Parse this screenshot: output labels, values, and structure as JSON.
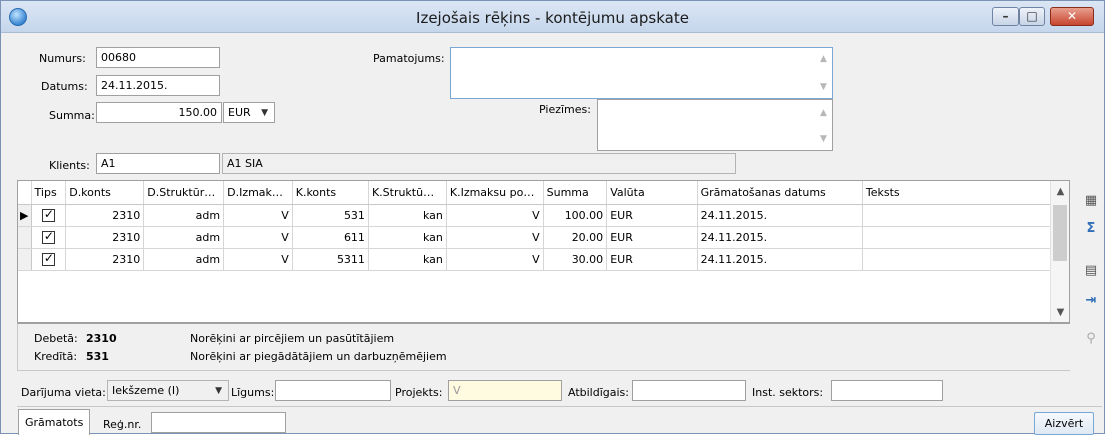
{
  "window": {
    "title": "Izejošais rēķins - kontējumu apskate",
    "min": "–",
    "max": "□",
    "close": "✕"
  },
  "header": {
    "numurs_label": "Numurs:",
    "numurs": "00680",
    "datums_label": "Datums:",
    "datums": "24.11.2015.",
    "summa_label": "Summa:",
    "summa": "150.00",
    "currency": "EUR",
    "pamatojums_label": "Pamatojums:",
    "piezimes_label": "Piezīmes:",
    "klients_label": "Klients:",
    "klients_code": "A1",
    "klients_name": "A1 SIA"
  },
  "grid": {
    "columns": [
      "Tips",
      "D.konts",
      "D.Struktūr…",
      "D.Izmak…",
      "K.konts",
      "K.Struktū…",
      "K.Izmaksu po…",
      "Summa",
      "Valūta",
      "Grāmatošanas datums",
      "Teksts"
    ],
    "rows": [
      {
        "dkonts": "2310",
        "dstr": "adm",
        "dizm": "V",
        "kkonts": "531",
        "kstr": "kan",
        "kizm": "V",
        "summa": "100.00",
        "valuta": "EUR",
        "datums": "24.11.2015.",
        "teksts": ""
      },
      {
        "dkonts": "2310",
        "dstr": "adm",
        "dizm": "V",
        "kkonts": "611",
        "kstr": "kan",
        "kizm": "V",
        "summa": "20.00",
        "valuta": "EUR",
        "datums": "24.11.2015.",
        "teksts": ""
      },
      {
        "dkonts": "2310",
        "dstr": "adm",
        "dizm": "V",
        "kkonts": "5311",
        "kstr": "kan",
        "kizm": "V",
        "summa": "30.00",
        "valuta": "EUR",
        "datums": "24.11.2015.",
        "teksts": ""
      }
    ]
  },
  "info": {
    "debet_label": "Debetā:",
    "debet_value": "2310",
    "debet_desc": "Norēķini ar pircējiem un pasūtītājiem",
    "kredit_label": "Kredītā:",
    "kredit_value": "531",
    "kredit_desc": "Norēķini ar piegādātājiem un darbuzņēmējiem"
  },
  "bottom": {
    "darijuma_label": "Darījuma vieta:",
    "darijuma_value": "Iekšzeme (I)",
    "ligums_label": "Līgums:",
    "projekts_label": "Projekts:",
    "projekts_value": "V",
    "atbildigais_label": "Atbildīgais:",
    "inst_label": "Inst. sektors:"
  },
  "footer": {
    "gramatots": "Grāmatots",
    "regnr_label": "Reģ.nr.",
    "close_button": "Aizvērt"
  }
}
